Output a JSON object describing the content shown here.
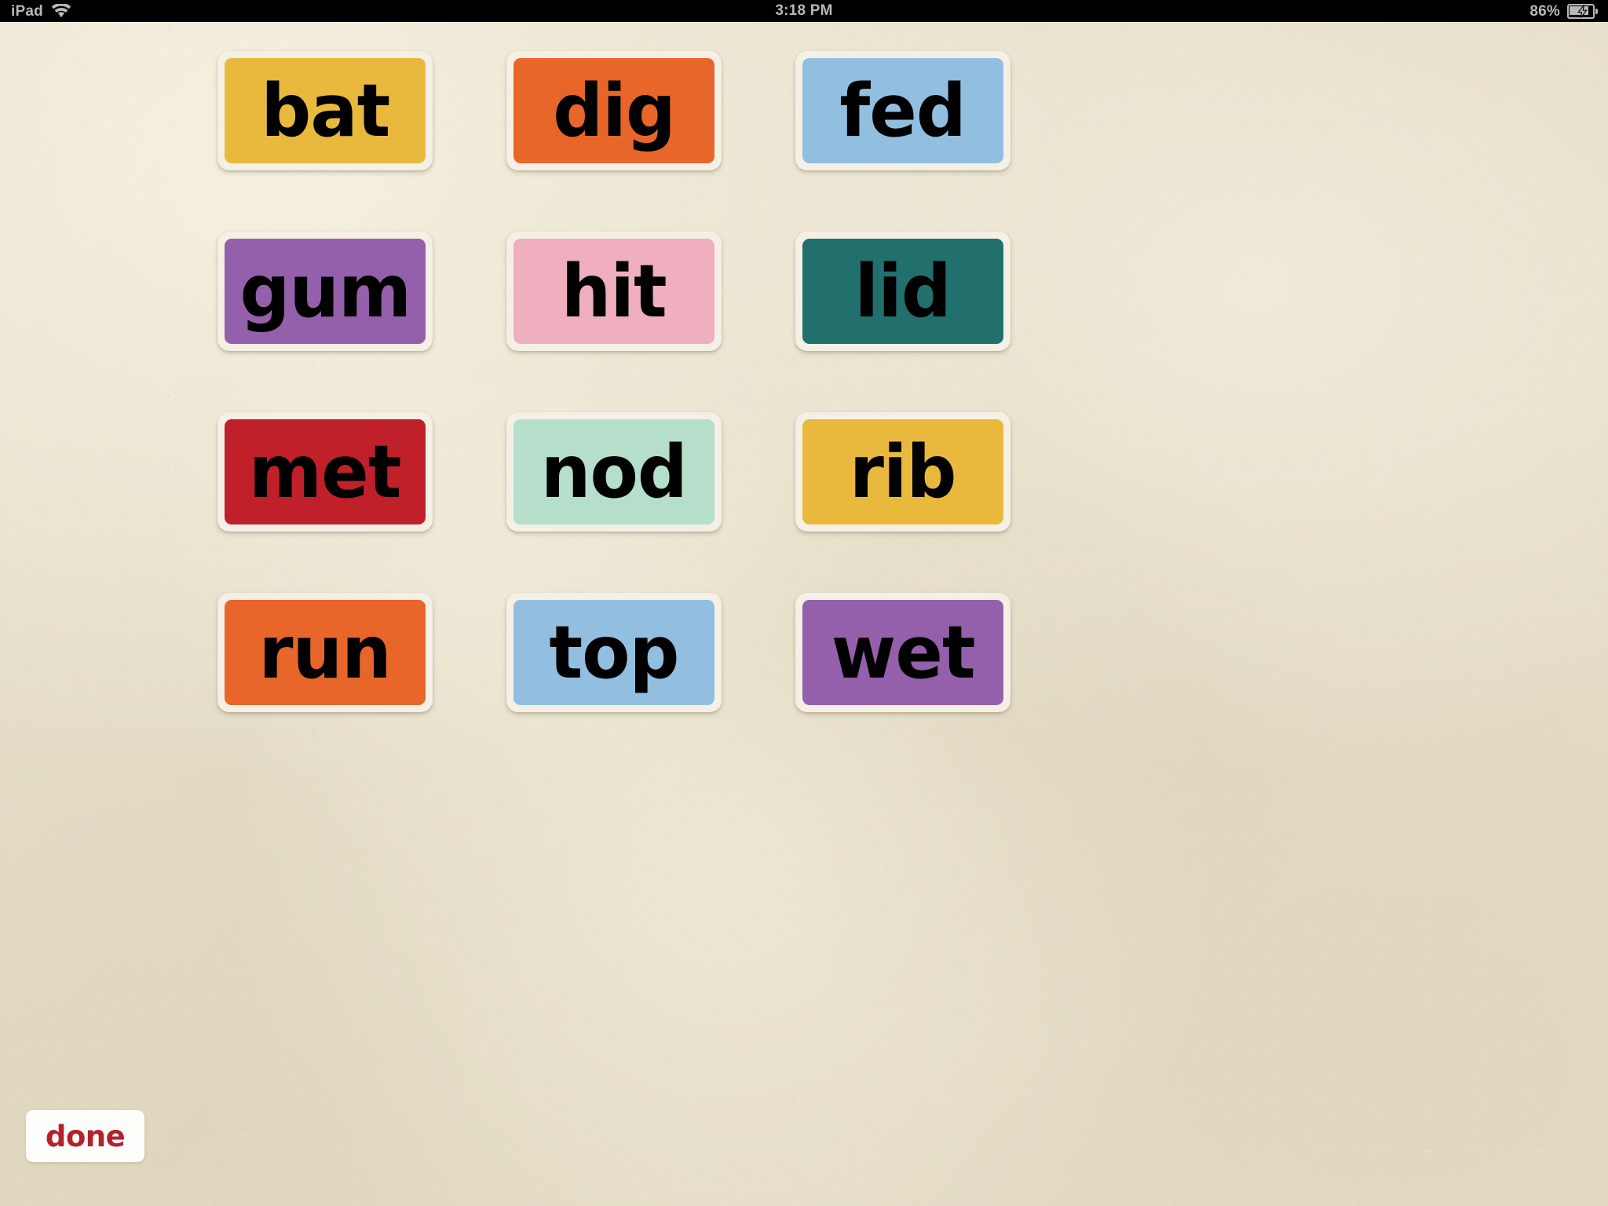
{
  "status_bar": {
    "device_label": "iPad",
    "wifi_icon": "wifi-icon",
    "time": "3:18 PM",
    "battery_percent": "86%",
    "battery_icon": "battery-charging-icon"
  },
  "theme": {
    "background_paper": "#e6dec8",
    "tile_frame": "#f4f0e6",
    "tile_text": "#000000",
    "done_text": "#b5202c",
    "done_background": "#fdfdfb",
    "status_bar_background": "#000000",
    "status_bar_text": "#b8b8b8"
  },
  "word_tiles": [
    {
      "word": "bat",
      "color": "#e9b93e"
    },
    {
      "word": "dig",
      "color": "#e8662a"
    },
    {
      "word": "fed",
      "color": "#92bee0"
    },
    {
      "word": "gum",
      "color": "#9560ab"
    },
    {
      "word": "hit",
      "color": "#efafbe"
    },
    {
      "word": "lid",
      "color": "#22706e"
    },
    {
      "word": "met",
      "color": "#bf2029"
    },
    {
      "word": "nod",
      "color": "#b5decb"
    },
    {
      "word": "rib",
      "color": "#e9b93e"
    },
    {
      "word": "run",
      "color": "#e8662a"
    },
    {
      "word": "top",
      "color": "#92bee0"
    },
    {
      "word": "wet",
      "color": "#9560ab"
    }
  ],
  "footer": {
    "done_label": "done"
  }
}
